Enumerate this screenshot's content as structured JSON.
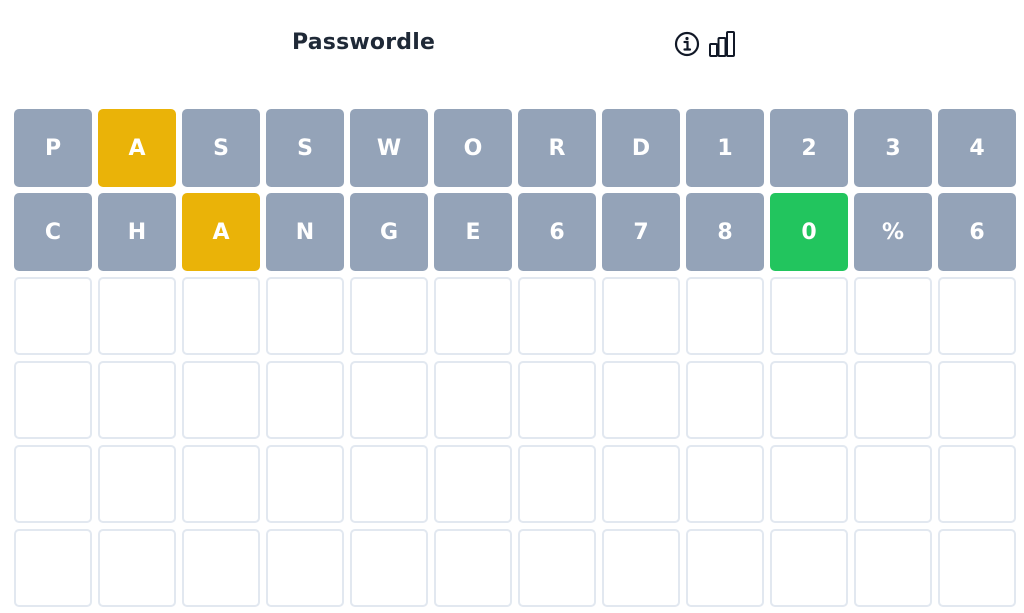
{
  "header": {
    "title": "Passwordle",
    "icons": [
      "info-icon",
      "stats-icon"
    ]
  },
  "colors": {
    "absent": "#94a3b8",
    "present": "#eab308",
    "correct": "#22c55e",
    "empty_border": "#e2e8f0",
    "text": "#1f2937"
  },
  "board": {
    "columns": 12,
    "rows": [
      {
        "letters": [
          "P",
          "A",
          "S",
          "S",
          "W",
          "O",
          "R",
          "D",
          "1",
          "2",
          "3",
          "4"
        ],
        "states": [
          "absent",
          "present",
          "absent",
          "absent",
          "absent",
          "absent",
          "absent",
          "absent",
          "absent",
          "absent",
          "absent",
          "absent"
        ]
      },
      {
        "letters": [
          "C",
          "H",
          "A",
          "N",
          "G",
          "E",
          "6",
          "7",
          "8",
          "0",
          "%",
          "6"
        ],
        "states": [
          "absent",
          "absent",
          "present",
          "absent",
          "absent",
          "absent",
          "absent",
          "absent",
          "absent",
          "correct",
          "absent",
          "absent"
        ]
      },
      {
        "letters": [],
        "states": []
      },
      {
        "letters": [],
        "states": []
      },
      {
        "letters": [],
        "states": []
      },
      {
        "letters": [],
        "states": []
      }
    ]
  }
}
